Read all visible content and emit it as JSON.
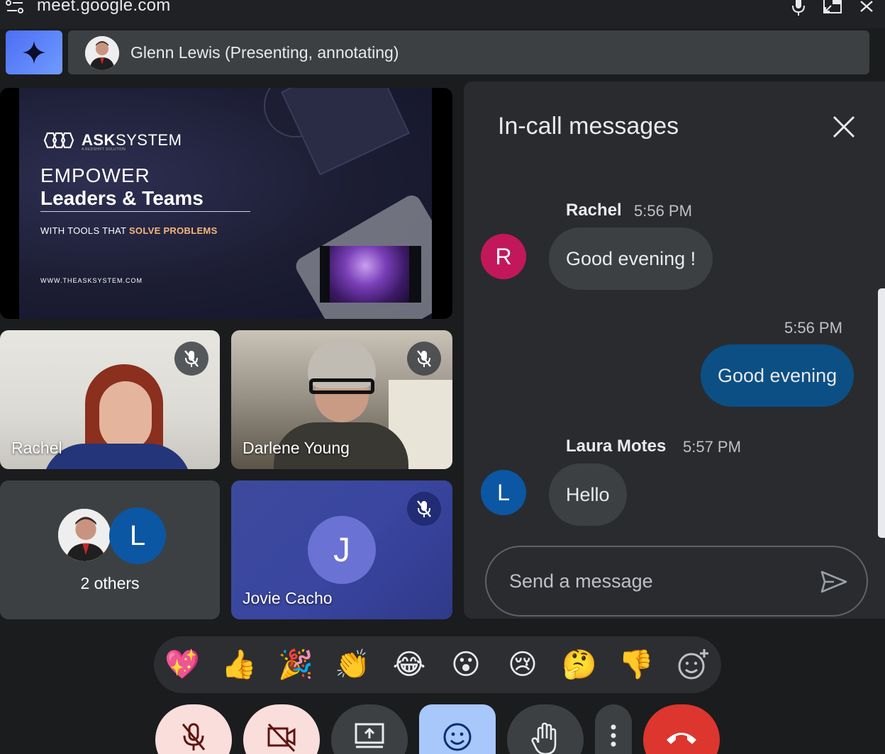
{
  "browser": {
    "url": "meet.google.com"
  },
  "banner": {
    "presenter_text": "Glenn Lewis (Presenting, annotating)"
  },
  "slide": {
    "logo_bold": "ASK",
    "logo_rest": "SYSTEM",
    "logo_sub": "A REDSHIFT SOLUTION",
    "heading_line1": "EMPOWER",
    "heading_line2": "Leaders & Teams",
    "tagline_prefix": "WITH TOOLS THAT ",
    "tagline_highlight": "SOLVE PROBLEMS",
    "website": "WWW.THEASKSYSTEM.COM"
  },
  "participants": [
    {
      "name": "Rachel",
      "muted": true
    },
    {
      "name": "Darlene Young",
      "muted": true
    },
    {
      "name": "Jovie Cacho",
      "initial": "J",
      "muted": true
    }
  ],
  "others": {
    "label": "2 others",
    "initial": "L"
  },
  "chat": {
    "title": "In-call messages",
    "messages": [
      {
        "sender": "Rachel",
        "time": "5:56 PM",
        "text": "Good evening !",
        "initial": "R",
        "avatar_color": "#c2185b"
      },
      {
        "sender": "",
        "time": "5:56 PM",
        "text": "Good evening",
        "mine": true
      },
      {
        "sender": "Laura Motes",
        "time": "5:57 PM",
        "text": "Hello",
        "initial": "L",
        "avatar_color": "#0b57a3"
      }
    ],
    "input_placeholder": "Send a message"
  },
  "reactions": [
    "💖",
    "👍",
    "🎉",
    "👏",
    "😂",
    "😮",
    "😢",
    "🤔",
    "👎"
  ],
  "controls": {
    "colors": {
      "muted_bg": "#f9dedc",
      "active_bg": "#a8c7fa",
      "end_call": "#dc362e"
    }
  }
}
